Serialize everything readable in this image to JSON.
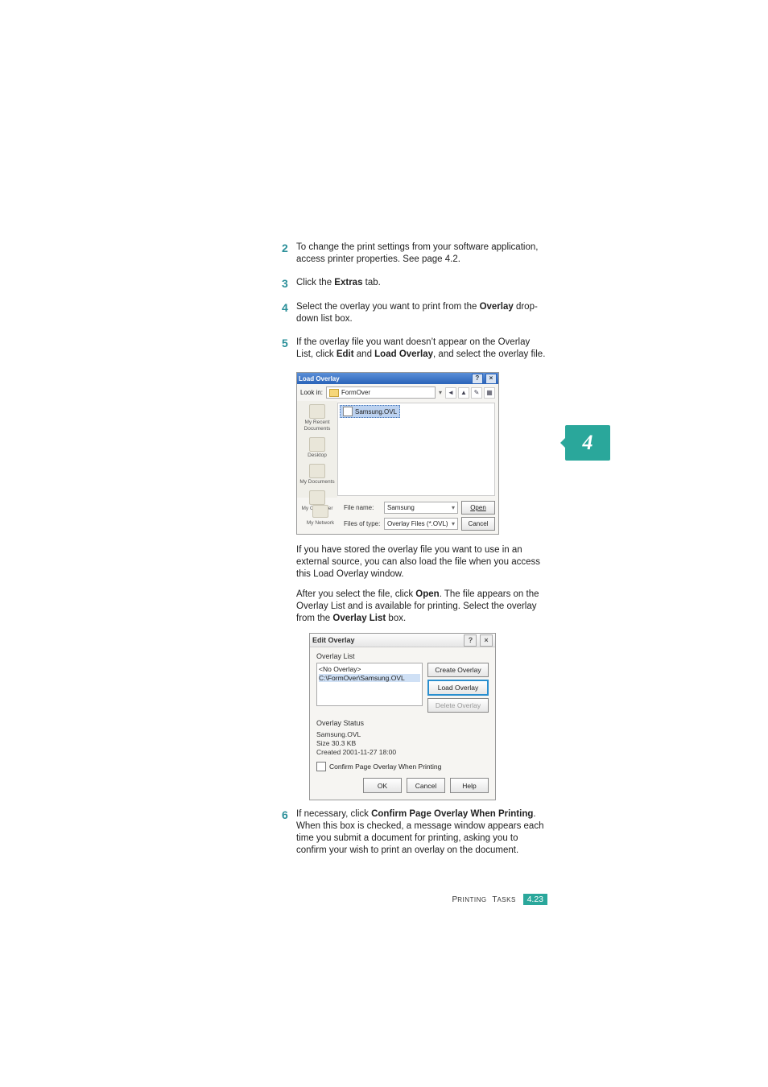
{
  "steps": {
    "s2": {
      "num": "2",
      "text_a": "To change the print settings from your software application, access printer properties. See ",
      "ref": "page 4.2",
      "text_b": "."
    },
    "s3": {
      "num": "3",
      "text_a": "Click the ",
      "bold": "Extras",
      "text_b": " tab."
    },
    "s4": {
      "num": "4",
      "text_a": "Select the overlay you want to print from the ",
      "bold": "Overlay",
      "text_b": " drop-down list box."
    },
    "s5": {
      "num": "5",
      "text_a": "If the overlay file you want doesn’t appear on the Overlay List, click ",
      "bold1": "Edit",
      "mid": " and ",
      "bold2": "Load Overlay",
      "text_b": ", and select the overlay file."
    },
    "s6": {
      "num": "6",
      "text_a": "If necessary, click ",
      "bold": "Confirm Page Overlay When Printing",
      "text_b": ". When this box is checked, a message window appears each time you submit a document for printing, asking you to confirm your wish to print an overlay on the document."
    }
  },
  "prose1": {
    "text": "If you have stored the overlay file you want to use in an external source, you can also load the file when you access this Load Overlay window."
  },
  "prose2": {
    "a": "After you select the file, click ",
    "b": "Open",
    "c": ". The file appears on the Overlay List and is available for printing. Select the overlay from the ",
    "d": "Overlay List",
    "e": " box."
  },
  "side_tab": "4",
  "load_overlay": {
    "title": "Load Overlay",
    "lookin_label": "Look in:",
    "lookin_value": "FormOver",
    "toolbar_icons": [
      "back-icon",
      "up-icon",
      "new-folder-icon",
      "views-icon"
    ],
    "places": [
      "My Recent Documents",
      "Desktop",
      "My Documents",
      "My Computer"
    ],
    "file_selected": "Samsung.OVL",
    "network_label": "My Network",
    "filename_label": "File name:",
    "filename_value": "Samsung",
    "filetype_label": "Files of type:",
    "filetype_value": "Overlay Files (*.OVL)",
    "open_btn": "Open",
    "cancel_btn": "Cancel"
  },
  "edit_overlay": {
    "title": "Edit Overlay",
    "list_label": "Overlay List",
    "items": [
      "<No Overlay>",
      "C:\\FormOver\\Samsung.OVL"
    ],
    "btn_create": "Create Overlay",
    "btn_load": "Load Overlay",
    "btn_delete": "Delete Overlay",
    "status_label": "Overlay Status",
    "status_lines": [
      "Samsung.OVL",
      "Size 30.3 KB",
      "Created 2001-11-27 18:00"
    ],
    "confirm_label": "Confirm Page Overlay When Printing",
    "ok": "OK",
    "cancel": "Cancel",
    "help": "Help"
  },
  "footer": {
    "label_a": "P",
    "label_b": "RINTING ",
    "label_c": "T",
    "label_d": "ASKS",
    "page": "4.23"
  }
}
